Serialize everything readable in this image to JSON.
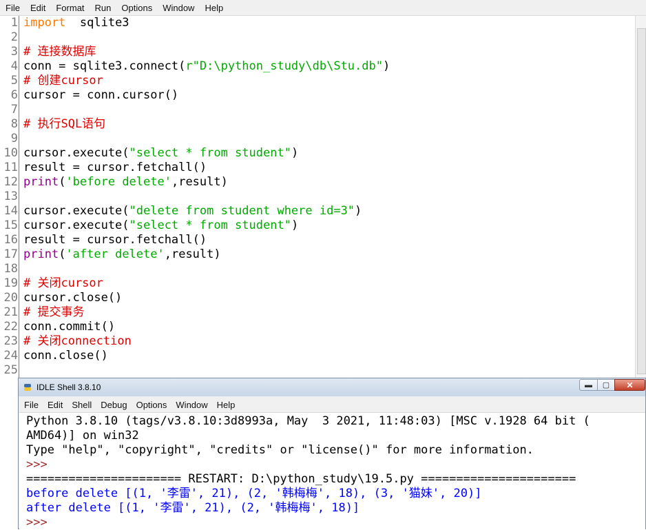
{
  "editor_menu": [
    "File",
    "Edit",
    "Format",
    "Run",
    "Options",
    "Window",
    "Help"
  ],
  "code_lines": [
    {
      "n": "1",
      "parts": [
        [
          "kw",
          "import"
        ],
        [
          "",
          "  sqlite3"
        ]
      ]
    },
    {
      "n": "2",
      "parts": []
    },
    {
      "n": "3",
      "parts": [
        [
          "cm",
          "# 连接数据库"
        ]
      ]
    },
    {
      "n": "4",
      "parts": [
        [
          "",
          "conn = sqlite3.connect("
        ],
        [
          "str",
          "r\"D:\\python_study\\db\\Stu.db\""
        ],
        [
          "",
          ")"
        ]
      ]
    },
    {
      "n": "5",
      "parts": [
        [
          "cm",
          "# 创建cursor"
        ]
      ]
    },
    {
      "n": "6",
      "parts": [
        [
          "",
          "cursor = conn.cursor()"
        ]
      ]
    },
    {
      "n": "7",
      "parts": []
    },
    {
      "n": "8",
      "parts": [
        [
          "cm",
          "# 执行SQL语句"
        ]
      ]
    },
    {
      "n": "9",
      "parts": []
    },
    {
      "n": "10",
      "parts": [
        [
          "",
          "cursor.execute("
        ],
        [
          "str",
          "\"select * from student\""
        ],
        [
          "",
          ")"
        ]
      ]
    },
    {
      "n": "11",
      "parts": [
        [
          "",
          "result = cursor.fetchall()"
        ]
      ]
    },
    {
      "n": "12",
      "parts": [
        [
          "bi",
          "print"
        ],
        [
          "",
          "("
        ],
        [
          "str",
          "'before delete'"
        ],
        [
          "",
          ",result)"
        ]
      ]
    },
    {
      "n": "13",
      "parts": []
    },
    {
      "n": "14",
      "parts": [
        [
          "",
          "cursor.execute("
        ],
        [
          "str",
          "\"delete from student where id=3\""
        ],
        [
          "",
          ")"
        ]
      ]
    },
    {
      "n": "15",
      "parts": [
        [
          "",
          "cursor.execute("
        ],
        [
          "str",
          "\"select * from student\""
        ],
        [
          "",
          ")"
        ]
      ]
    },
    {
      "n": "16",
      "parts": [
        [
          "",
          "result = cursor.fetchall()"
        ]
      ]
    },
    {
      "n": "17",
      "parts": [
        [
          "bi",
          "print"
        ],
        [
          "",
          "("
        ],
        [
          "str",
          "'after delete'"
        ],
        [
          "",
          ",result)"
        ]
      ]
    },
    {
      "n": "18",
      "parts": []
    },
    {
      "n": "19",
      "parts": [
        [
          "cm",
          "# 关闭cursor"
        ]
      ]
    },
    {
      "n": "20",
      "parts": [
        [
          "",
          "cursor.close()"
        ]
      ]
    },
    {
      "n": "21",
      "parts": [
        [
          "cm",
          "# 提交事务"
        ]
      ]
    },
    {
      "n": "22",
      "parts": [
        [
          "",
          "conn.commit()"
        ]
      ]
    },
    {
      "n": "23",
      "parts": [
        [
          "cm",
          "# 关闭connection"
        ]
      ]
    },
    {
      "n": "24",
      "parts": [
        [
          "",
          "conn.close()"
        ]
      ]
    },
    {
      "n": "25",
      "parts": []
    }
  ],
  "shell": {
    "title": "IDLE Shell 3.8.10",
    "menu": [
      "File",
      "Edit",
      "Shell",
      "Debug",
      "Options",
      "Window",
      "Help"
    ],
    "buttons": {
      "minimize": "▬",
      "maximize": "▢",
      "close": "✕"
    },
    "lines": [
      {
        "cls": "black",
        "text": "Python 3.8.10 (tags/v3.8.10:3d8993a, May  3 2021, 11:48:03) [MSC v.1928 64 bit ("
      },
      {
        "cls": "black",
        "text": "AMD64)] on win32"
      },
      {
        "cls": "black",
        "text": "Type \"help\", \"copyright\", \"credits\" or \"license()\" for more information."
      },
      {
        "cls": "brown",
        "text": ">>>"
      },
      {
        "cls": "black",
        "text": "====================== RESTART: D:\\python_study\\19.5.py ======================"
      },
      {
        "cls": "blue",
        "text": "before delete [(1, '李雷', 21), (2, '韩梅梅', 18), (3, '猫妹', 20)]"
      },
      {
        "cls": "blue",
        "text": "after delete [(1, '李雷', 21), (2, '韩梅梅', 18)]"
      },
      {
        "cls": "brown",
        "text": ">>>"
      }
    ]
  }
}
